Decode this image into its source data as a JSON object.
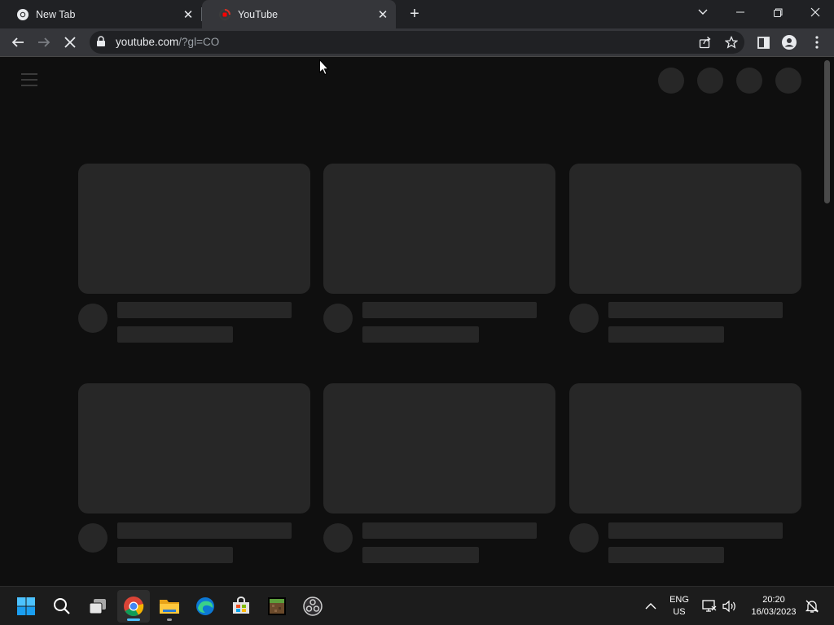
{
  "browser": {
    "tabs": [
      {
        "title": "New Tab",
        "favicon": "chrome-icon",
        "active": false
      },
      {
        "title": "YouTube",
        "favicon": "youtube-loading-icon",
        "active": true
      }
    ],
    "address": {
      "host": "youtube.com",
      "path": "/?gl=CO"
    },
    "accent_colors": {
      "frame": "#202124",
      "toolbar": "#35363a",
      "page_bg": "#0f0f0f",
      "skeleton": "#272727"
    }
  },
  "page": {
    "state": "loading-skeleton",
    "header_icons": [
      "skeleton-circle",
      "skeleton-circle",
      "skeleton-circle",
      "skeleton-circle"
    ],
    "video_grid": {
      "rows": 2,
      "columns": 3
    }
  },
  "taskbar": {
    "apps": [
      "start-icon",
      "search-icon",
      "task-view-icon",
      "chrome-icon",
      "file-explorer-icon",
      "edge-icon",
      "microsoft-store-icon",
      "minecraft-icon",
      "obs-icon"
    ],
    "language": {
      "line1": "ENG",
      "line2": "US"
    },
    "clock": {
      "time": "20:20",
      "date": "16/03/2023"
    }
  }
}
